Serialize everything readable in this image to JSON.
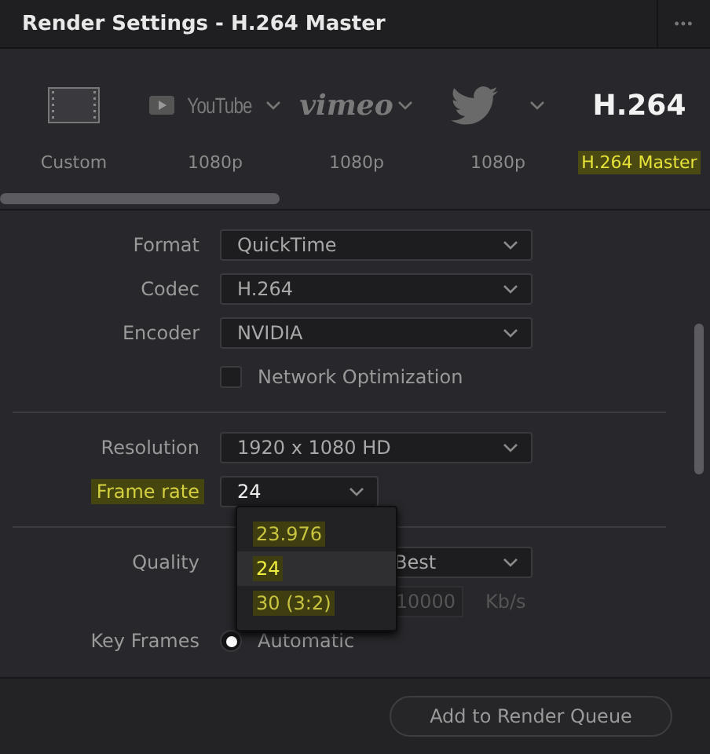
{
  "window": {
    "title": "Render Settings - H.264 Master",
    "menu_button": "•••"
  },
  "presets": [
    {
      "kind": "film",
      "label": "Custom",
      "selected": false,
      "highlighted": false
    },
    {
      "kind": "youtube",
      "logo": "YouTube",
      "label": "1080p",
      "selected": false,
      "highlighted": false,
      "has_menu": true
    },
    {
      "kind": "vimeo",
      "logo": "vimeo",
      "label": "1080p",
      "selected": false,
      "highlighted": false,
      "has_menu": true
    },
    {
      "kind": "twitter",
      "label": "1080p",
      "selected": false,
      "highlighted": false,
      "has_menu": true
    },
    {
      "kind": "text",
      "logo": "H.264",
      "label": "H.264 Master",
      "selected": true,
      "highlighted": true
    }
  ],
  "video_settings": [
    {
      "kind": "select",
      "label": "Format",
      "value": "QuickTime",
      "highlighted": false
    },
    {
      "kind": "select",
      "label": "Codec",
      "value": "H.264",
      "highlighted": false
    },
    {
      "kind": "select",
      "label": "Encoder",
      "value": "NVIDIA",
      "highlighted": false
    },
    {
      "kind": "checkbox",
      "label": "Network Optimization",
      "checked": false
    },
    {
      "kind": "divider"
    },
    {
      "kind": "select",
      "label": "Resolution",
      "value": "1920 x 1080 HD",
      "highlighted": false
    },
    {
      "kind": "select",
      "label": "Frame rate",
      "value": "24",
      "highlighted": true,
      "short": true
    },
    {
      "kind": "divider"
    },
    {
      "kind": "select",
      "label": "Quality",
      "value": "Best",
      "highlighted": false,
      "covered": true
    },
    {
      "kind": "bitrate",
      "value": "10000",
      "unit": "Kb/s"
    },
    {
      "kind": "radio",
      "label": "Key Frames",
      "option": "Automatic",
      "selected": true
    }
  ],
  "frame_rate_menu": [
    {
      "label": "23.976",
      "selected": false,
      "highlighted": true
    },
    {
      "label": "24",
      "selected": true,
      "highlighted": true
    },
    {
      "label": "30 (3:2)",
      "selected": false,
      "highlighted": true
    }
  ],
  "footer": {
    "button": "Add to Render Queue"
  }
}
